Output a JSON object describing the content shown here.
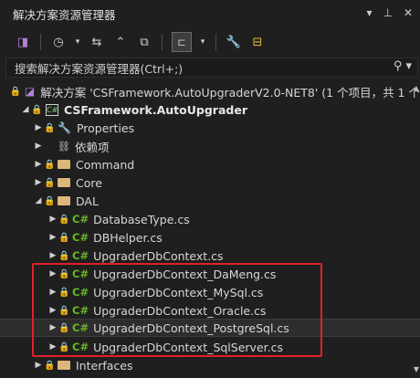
{
  "panel": {
    "title": "解决方案资源管理器",
    "dropdown_icon": "chevron-down-icon",
    "pin_icon": "pin-icon",
    "close_icon": "close-icon"
  },
  "search": {
    "placeholder": "搜索解决方案资源管理器(Ctrl+;)"
  },
  "tree": {
    "solution": "解决方案 'CSFramework.AutoUpgraderV2.0-NET8' (1 个项目，共 1 个",
    "project": "CSFramework.AutoUpgrader",
    "properties": "Properties",
    "dependencies": "依赖项",
    "command": "Command",
    "core": "Core",
    "dal": "DAL",
    "cs_prefix": "C#",
    "files": [
      "DatabaseType.cs",
      "DBHelper.cs",
      "UpgraderDbContext.cs",
      "UpgraderDbContext_DaMeng.cs",
      "UpgraderDbContext_MySql.cs",
      "UpgraderDbContext_Oracle.cs",
      "UpgraderDbContext_PostgreSql.cs",
      "UpgraderDbContext_SqlServer.cs"
    ],
    "interfaces": "Interfaces"
  },
  "colors": {
    "background": "#1f1f1f",
    "csharp": "#68b723",
    "folder": "#dcb67a",
    "highlight": "#e0202a"
  }
}
